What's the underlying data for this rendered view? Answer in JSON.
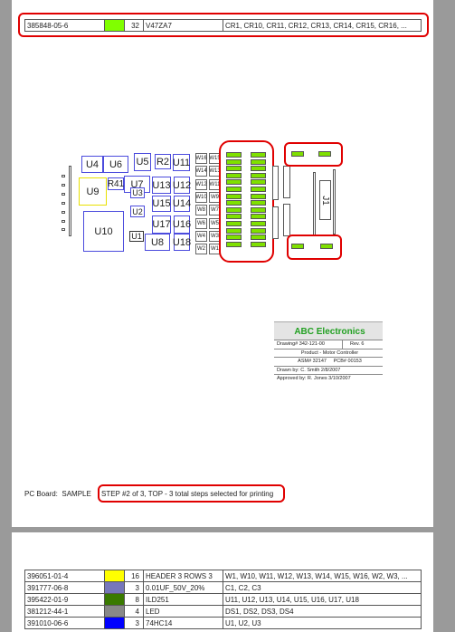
{
  "top_row": {
    "part": "385848-05-6",
    "color": "#80ff00",
    "qty": "32",
    "value": "V47ZA7",
    "refs": "CR1, CR10, CR11, CR12, CR13, CR14, CR15, CR16, ..."
  },
  "board": {
    "components": {
      "U4": "U4",
      "U6": "U6",
      "U5": "U5",
      "R2": "R2",
      "U11": "U11",
      "U9": "U9",
      "R41": "R41",
      "U7": "U7",
      "U13": "U13",
      "U12": "U12",
      "U3": "U3",
      "U15": "U15",
      "U14": "U14",
      "U2": "U2",
      "U10": "U10",
      "U17": "U17",
      "U16": "U16",
      "U1": "U1",
      "U8": "U8",
      "U18": "U18",
      "J1": "J1"
    },
    "w_left": [
      "W16",
      "W14",
      "W12",
      "W10",
      "W8",
      "W6",
      "W4",
      "W2"
    ],
    "w_right": [
      "W15",
      "W13",
      "W11",
      "W9",
      "W7",
      "W5",
      "W3",
      "W1"
    ],
    "highlight_color": "#e00000",
    "cr_color": "#80ff00"
  },
  "title_block": {
    "company": "ABC Electronics",
    "drawing": "Drawing# 342-121-00",
    "rev": "Rev. 6",
    "product": "Product - Motor Controller",
    "asm": "ASM# 32147     PCB# 00153",
    "drawn": "Drawn by: C. Smith  2/8/2007",
    "approved": "Approved by: R. Jones  3/10/2007"
  },
  "footer": {
    "board": "PC Board:  SAMPLE",
    "step": "STEP #2 of 3, TOP - 3 total steps selected for printing"
  },
  "bom_rows": [
    {
      "part": "396051-01-4",
      "color": "#ffff00",
      "qty": "16",
      "value": "HEADER 3 ROWS 3",
      "refs": "W1, W10, W11, W12, W13, W14, W15, W16, W2, W3, ..."
    },
    {
      "part": "391777-06-8",
      "color": "#7777bb",
      "qty": "3",
      "value": "0.01UF_50V_20%",
      "refs": "C1, C2, C3"
    },
    {
      "part": "395422-01-9",
      "color": "#3a7a00",
      "qty": "8",
      "value": "ILD251",
      "refs": "U11, U12, U13, U14, U15, U16, U17, U18"
    },
    {
      "part": "381212-44-1",
      "color": "#888888",
      "qty": "4",
      "value": "LED",
      "refs": "DS1, DS2, DS3, DS4"
    },
    {
      "part": "391010-06-6",
      "color": "#0000ff",
      "qty": "3",
      "value": "74HC14",
      "refs": "U1, U2, U3"
    }
  ]
}
